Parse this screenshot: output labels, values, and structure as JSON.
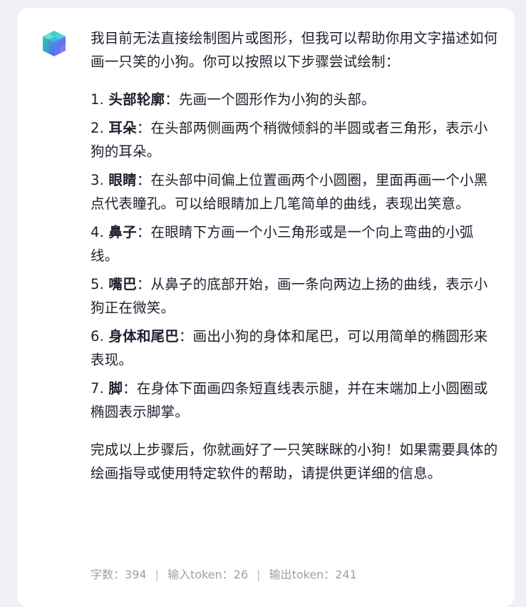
{
  "message": {
    "intro": "我目前无法直接绘制图片或图形，但我可以帮助你用文字描述如何画一只笑的小狗。你可以按照以下步骤尝试绘制：",
    "steps": [
      {
        "num": "1.",
        "title": "头部轮廓",
        "text": "：先画一个圆形作为小狗的头部。"
      },
      {
        "num": "2.",
        "title": "耳朵",
        "text": "：在头部两侧画两个稍微倾斜的半圆或者三角形，表示小狗的耳朵。"
      },
      {
        "num": "3.",
        "title": "眼睛",
        "text": "：在头部中间偏上位置画两个小圆圈，里面再画一个小黑点代表瞳孔。可以给眼睛加上几笔简单的曲线，表现出笑意。"
      },
      {
        "num": "4.",
        "title": "鼻子",
        "text": "：在眼睛下方画一个小三角形或是一个向上弯曲的小弧线。"
      },
      {
        "num": "5.",
        "title": "嘴巴",
        "text": "：从鼻子的底部开始，画一条向两边上扬的曲线，表示小狗正在微笑。"
      },
      {
        "num": "6.",
        "title": "身体和尾巴",
        "text": "：画出小狗的身体和尾巴，可以用简单的椭圆形来表现。"
      },
      {
        "num": "7.",
        "title": "脚",
        "text": "：在身体下面画四条短直线表示腿，并在末端加上小圆圈或椭圆表示脚掌。"
      }
    ],
    "outro": "完成以上步骤后，你就画好了一只笑眯眯的小狗！如果需要具体的绘画指导或使用特定软件的帮助，请提供更详细的信息。"
  },
  "footer": {
    "word_count": "字数：394",
    "input_tokens": "输入token：26",
    "output_tokens": "输出token：241",
    "separator": "|"
  },
  "avatar_icon": "cube-logo-icon",
  "colors": {
    "background": "#eef0f6",
    "card": "#ffffff",
    "text": "#1f1f2e",
    "muted": "#9aa0ad",
    "logo_teal": "#3fd0b0",
    "logo_blue": "#4a7cf0",
    "logo_purple": "#8a6cf2"
  }
}
